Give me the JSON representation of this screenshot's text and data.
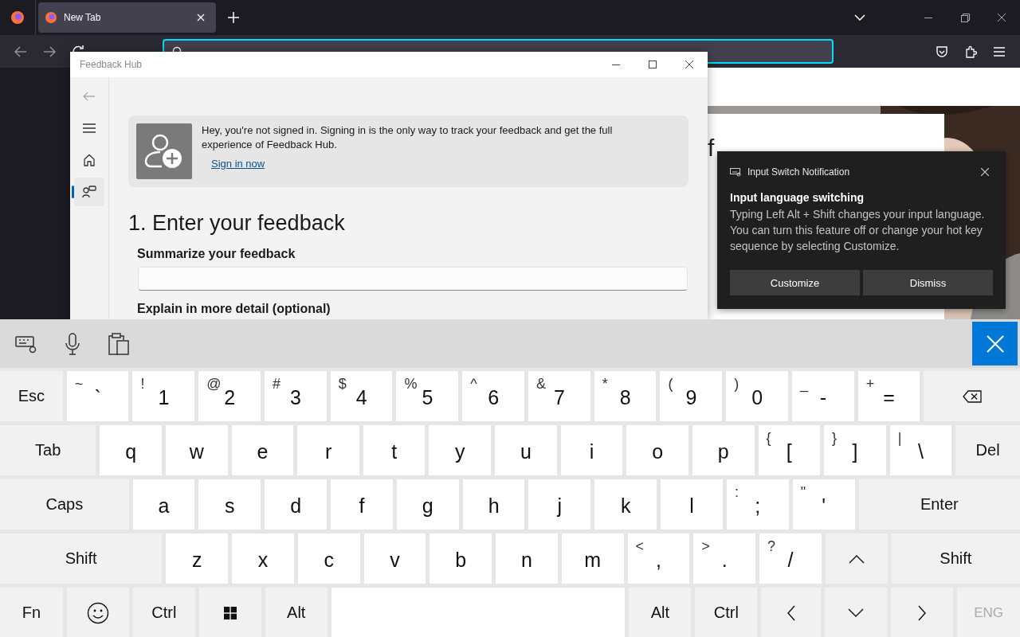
{
  "browser": {
    "tabs": [
      {
        "title": "New Tab",
        "selected": true
      }
    ],
    "page": {
      "heading_fragment": "f"
    }
  },
  "feedback_hub": {
    "title": "Feedback Hub",
    "nav": [
      {
        "kind": "back",
        "selected": false,
        "disabled": true
      },
      {
        "kind": "menu",
        "selected": false,
        "disabled": false
      },
      {
        "kind": "home",
        "selected": false,
        "disabled": false
      },
      {
        "kind": "feedback",
        "selected": true,
        "disabled": false
      }
    ],
    "banner": {
      "message": "Hey, you're not signed in. Signing in is the only way to track your feedback and get the full experience of Feedback Hub.",
      "link": "Sign in now"
    },
    "heading": "1. Enter your feedback",
    "fields": [
      {
        "label": "Summarize your feedback",
        "has_box": true
      },
      {
        "label": "Explain in more detail (optional)",
        "has_box": false
      }
    ]
  },
  "notification": {
    "app": "Input Switch Notification",
    "title": "Input language switching",
    "body": "Typing Left Alt + Shift changes your input language. You can turn this feature off or change your hot key sequence by selecting Customize.",
    "buttons": [
      "Customize",
      "Dismiss"
    ]
  },
  "keyboard": {
    "rows": [
      {
        "keys": [
          {
            "kind": "fn",
            "label": "Esc",
            "disabled": false
          },
          {
            "kind": "char",
            "label": "`",
            "shift": "~",
            "disabled": false
          },
          {
            "kind": "char",
            "label": "1",
            "shift": "!",
            "disabled": false
          },
          {
            "kind": "char",
            "label": "2",
            "shift": "@",
            "disabled": false
          },
          {
            "kind": "char",
            "label": "3",
            "shift": "#",
            "disabled": false
          },
          {
            "kind": "char",
            "label": "4",
            "shift": "$",
            "disabled": false
          },
          {
            "kind": "char",
            "label": "5",
            "shift": "%",
            "disabled": false
          },
          {
            "kind": "char",
            "label": "6",
            "shift": "^",
            "disabled": false
          },
          {
            "kind": "char",
            "label": "7",
            "shift": "&",
            "disabled": false
          },
          {
            "kind": "char",
            "label": "8",
            "shift": "*",
            "disabled": false
          },
          {
            "kind": "char",
            "label": "9",
            "shift": "(",
            "disabled": false
          },
          {
            "kind": "char",
            "label": "0",
            "shift": ")",
            "disabled": false
          },
          {
            "kind": "char",
            "label": "-",
            "shift": "_",
            "disabled": false
          },
          {
            "kind": "char",
            "label": "=",
            "shift": "+",
            "disabled": false
          },
          {
            "kind": "backspace",
            "disabled": false
          }
        ]
      },
      {
        "keys": [
          {
            "kind": "fn",
            "label": "Tab",
            "disabled": false
          },
          {
            "kind": "char",
            "label": "q",
            "disabled": false
          },
          {
            "kind": "char",
            "label": "w",
            "disabled": false
          },
          {
            "kind": "char",
            "label": "e",
            "disabled": false
          },
          {
            "kind": "char",
            "label": "r",
            "disabled": false
          },
          {
            "kind": "char",
            "label": "t",
            "disabled": false
          },
          {
            "kind": "char",
            "label": "y",
            "disabled": false
          },
          {
            "kind": "char",
            "label": "u",
            "disabled": false
          },
          {
            "kind": "char",
            "label": "i",
            "disabled": false
          },
          {
            "kind": "char",
            "label": "o",
            "disabled": false
          },
          {
            "kind": "char",
            "label": "p",
            "disabled": false
          },
          {
            "kind": "char",
            "label": "[",
            "shift": "{",
            "disabled": false
          },
          {
            "kind": "char",
            "label": "]",
            "shift": "}",
            "disabled": false
          },
          {
            "kind": "char",
            "label": "\\",
            "shift": "|",
            "disabled": false
          },
          {
            "kind": "fn",
            "label": "Del",
            "disabled": false
          }
        ]
      },
      {
        "keys": [
          {
            "kind": "fn",
            "label": "Caps",
            "disabled": false
          },
          {
            "kind": "char",
            "label": "a",
            "disabled": false
          },
          {
            "kind": "char",
            "label": "s",
            "disabled": false
          },
          {
            "kind": "char",
            "label": "d",
            "disabled": false
          },
          {
            "kind": "char",
            "label": "f",
            "disabled": false
          },
          {
            "kind": "char",
            "label": "g",
            "disabled": false
          },
          {
            "kind": "char",
            "label": "h",
            "disabled": false
          },
          {
            "kind": "char",
            "label": "j",
            "disabled": false
          },
          {
            "kind": "char",
            "label": "k",
            "disabled": false
          },
          {
            "kind": "char",
            "label": "l",
            "disabled": false
          },
          {
            "kind": "char",
            "label": ";",
            "shift": ":",
            "disabled": false
          },
          {
            "kind": "char",
            "label": "'",
            "shift": "\"",
            "disabled": false
          },
          {
            "kind": "fn",
            "label": "Enter",
            "disabled": false
          }
        ]
      },
      {
        "keys": [
          {
            "kind": "fn",
            "label": "Shift",
            "disabled": false
          },
          {
            "kind": "char",
            "label": "z",
            "disabled": false
          },
          {
            "kind": "char",
            "label": "x",
            "disabled": false
          },
          {
            "kind": "char",
            "label": "c",
            "disabled": false
          },
          {
            "kind": "char",
            "label": "v",
            "disabled": false
          },
          {
            "kind": "char",
            "label": "b",
            "disabled": false
          },
          {
            "kind": "char",
            "label": "n",
            "disabled": false
          },
          {
            "kind": "char",
            "label": "m",
            "disabled": false
          },
          {
            "kind": "char",
            "label": ",",
            "shift": "<",
            "disabled": false
          },
          {
            "kind": "char",
            "label": ".",
            "shift": ">",
            "disabled": false
          },
          {
            "kind": "char",
            "label": "/",
            "shift": "?",
            "disabled": false
          },
          {
            "kind": "up",
            "disabled": false
          },
          {
            "kind": "fn",
            "label": "Shift",
            "disabled": false
          }
        ]
      },
      {
        "keys": [
          {
            "kind": "fn",
            "label": "Fn",
            "disabled": false
          },
          {
            "kind": "emoji",
            "disabled": false
          },
          {
            "kind": "fn",
            "label": "Ctrl",
            "disabled": false
          },
          {
            "kind": "windows",
            "disabled": false
          },
          {
            "kind": "fn",
            "label": "Alt",
            "disabled": false
          },
          {
            "kind": "space",
            "disabled": false
          },
          {
            "kind": "fn",
            "label": "Alt",
            "disabled": false
          },
          {
            "kind": "fn",
            "label": "Ctrl",
            "disabled": false
          },
          {
            "kind": "left",
            "disabled": false
          },
          {
            "kind": "down",
            "disabled": false
          },
          {
            "kind": "right",
            "disabled": false
          },
          {
            "kind": "fn",
            "label": "ENG",
            "disabled": true
          }
        ]
      }
    ]
  }
}
